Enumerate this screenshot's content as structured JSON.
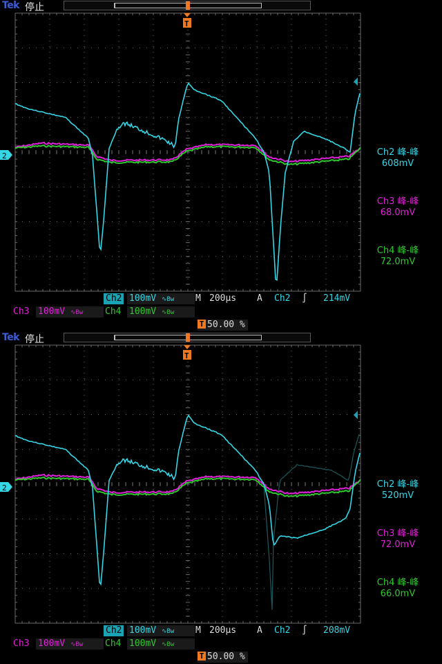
{
  "colors": {
    "ch2": "#35d6e6",
    "ch3": "#e020d8",
    "ch4": "#2fc82f",
    "trigger": "#f07820",
    "grid": "#6a6a6a"
  },
  "scopes": [
    {
      "brand": "Tek",
      "run_state": "停止",
      "ch2_marker": "2",
      "trigger_marker": "T",
      "readouts": [
        {
          "name": "Ch2 峰-峰",
          "value": "608mV"
        },
        {
          "name": "Ch3 峰-峰",
          "value": "68.0mV"
        },
        {
          "name": "Ch4 峰-峰",
          "value": "72.0mV"
        }
      ],
      "status": {
        "ch2_label": "Ch2",
        "ch2_scale": "100mV",
        "ch3_label": "Ch3",
        "ch3_scale": "100mV",
        "ch4_label": "Ch4",
        "ch4_scale": "100mV",
        "bw_symbol": "∿Bw",
        "timebase_prefix": "M",
        "timebase": "200µs",
        "trigger_mode": "A",
        "trigger_source": "Ch2",
        "trigger_slope": "∫",
        "trigger_level": "214mV",
        "trigger_position": "50.00 %"
      }
    },
    {
      "brand": "Tek",
      "run_state": "停止",
      "ch2_marker": "2",
      "trigger_marker": "T",
      "readouts": [
        {
          "name": "Ch2 峰-峰",
          "value": "520mV"
        },
        {
          "name": "Ch3 峰-峰",
          "value": "72.0mV"
        },
        {
          "name": "Ch4 峰-峰",
          "value": "66.0mV"
        }
      ],
      "status": {
        "ch2_label": "Ch2",
        "ch2_scale": "100mV",
        "ch3_label": "Ch3",
        "ch3_scale": "100mV",
        "ch4_label": "Ch4",
        "ch4_scale": "100mV",
        "bw_symbol": "∿Bw",
        "timebase_prefix": "M",
        "timebase": "200µs",
        "trigger_mode": "A",
        "trigger_source": "Ch2",
        "trigger_slope": "∫",
        "trigger_level": "208mV",
        "trigger_position": "50.00 %"
      }
    }
  ]
}
